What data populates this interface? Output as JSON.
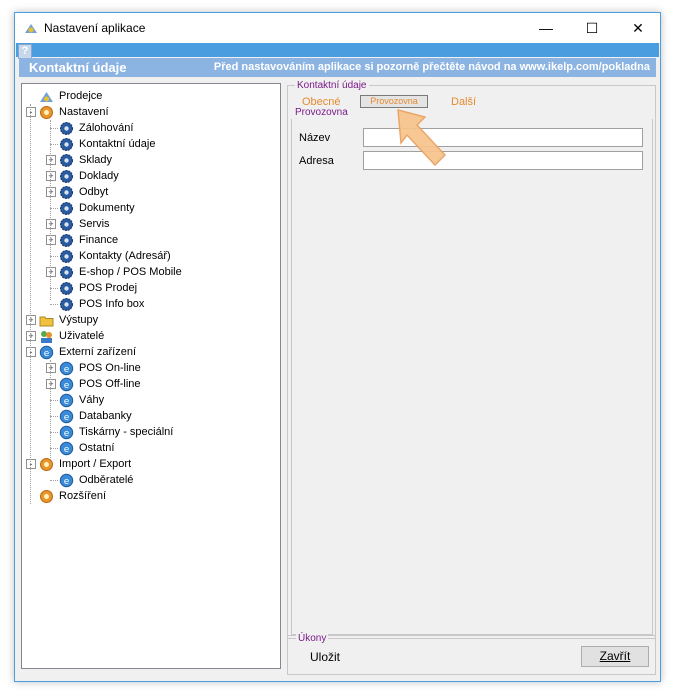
{
  "window": {
    "title": "Nastavení aplikace",
    "minimize": "—",
    "maximize": "☐",
    "close": "✕"
  },
  "menustrip": {
    "help": "?"
  },
  "banner": {
    "title": "Kontaktní údaje",
    "note": "Před nastavováním aplikace si pozorně přečtěte návod na www.ikelp.com/pokladna"
  },
  "tree": {
    "items": [
      {
        "label": "Prodejce",
        "icon": "shop-icon"
      },
      {
        "label": "Nastavení",
        "icon": "gear-orange-icon"
      },
      {
        "label": "Zálohování",
        "icon": "gear-blue-icon"
      },
      {
        "label": "Kontaktní údaje",
        "icon": "gear-blue-icon"
      },
      {
        "label": "Sklady",
        "icon": "gear-blue-icon"
      },
      {
        "label": "Doklady",
        "icon": "gear-blue-icon"
      },
      {
        "label": "Odbyt",
        "icon": "gear-blue-icon"
      },
      {
        "label": "Dokumenty",
        "icon": "gear-blue-icon"
      },
      {
        "label": "Servis",
        "icon": "gear-blue-icon"
      },
      {
        "label": "Finance",
        "icon": "gear-blue-icon"
      },
      {
        "label": "Kontakty (Adresář)",
        "icon": "gear-blue-icon"
      },
      {
        "label": "E-shop / POS Mobile",
        "icon": "gear-blue-icon"
      },
      {
        "label": "POS Prodej",
        "icon": "gear-blue-icon"
      },
      {
        "label": "POS Info box",
        "icon": "gear-blue-icon"
      },
      {
        "label": "Výstupy",
        "icon": "folder-icon"
      },
      {
        "label": "Uživatelé",
        "icon": "users-icon"
      },
      {
        "label": "Externí zařízení",
        "icon": "device-icon"
      },
      {
        "label": "POS On-line",
        "icon": "device-icon"
      },
      {
        "label": "POS Off-line",
        "icon": "device-icon"
      },
      {
        "label": "Váhy",
        "icon": "device-icon"
      },
      {
        "label": "Databanky",
        "icon": "device-icon"
      },
      {
        "label": "Tiskárny - speciální",
        "icon": "device-icon"
      },
      {
        "label": "Ostatní",
        "icon": "device-icon"
      },
      {
        "label": "Import / Export",
        "icon": "gear-orange-icon"
      },
      {
        "label": "Odběratelé",
        "icon": "device-icon"
      },
      {
        "label": "Rozšíření",
        "icon": "gear-orange-icon"
      }
    ]
  },
  "panel": {
    "group_title": "Kontaktní údaje",
    "tabs": [
      "Obecné",
      "Provozovna",
      "Další"
    ],
    "active_tab": "Provozovna",
    "section_title": "Provozovna",
    "fields": [
      {
        "label": "Název",
        "value": ""
      },
      {
        "label": "Adresa",
        "value": ""
      }
    ]
  },
  "actions": {
    "title": "Úkony",
    "save": "Uložit",
    "close": "Zavřít"
  },
  "colors": {
    "accent": "#4a9ee0",
    "banner": "#8cb4e2",
    "tab_text": "#e68b2c",
    "legend": "#7a1a8a"
  }
}
